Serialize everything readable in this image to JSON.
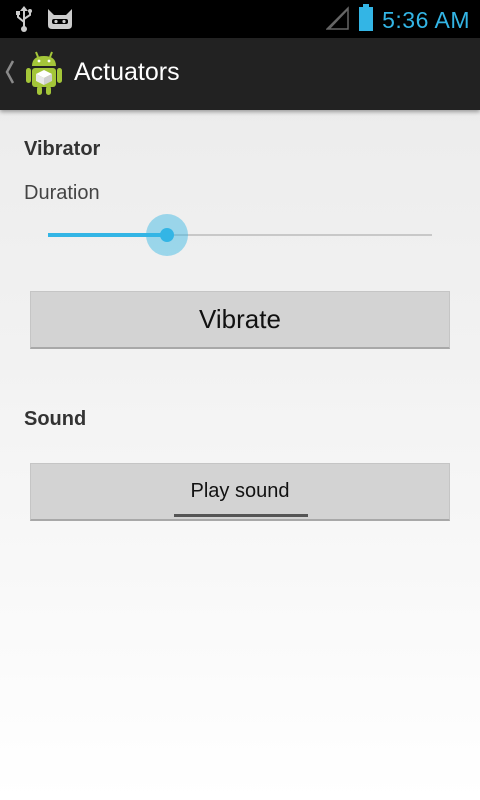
{
  "status_bar": {
    "time": "5:36 AM",
    "icons": [
      "usb-icon",
      "cyanogenmod-icon",
      "no-signal-icon",
      "battery-icon"
    ],
    "accent_color": "#33b5e5"
  },
  "action_bar": {
    "title": "Actuators",
    "icons": [
      "back-chevron-icon",
      "android-app-icon"
    ]
  },
  "vibrator": {
    "header": "Vibrator",
    "duration_label": "Duration",
    "duration_level": 0.31,
    "button_label": "Vibrate"
  },
  "sound": {
    "header": "Sound",
    "button_label": "Play sound"
  }
}
